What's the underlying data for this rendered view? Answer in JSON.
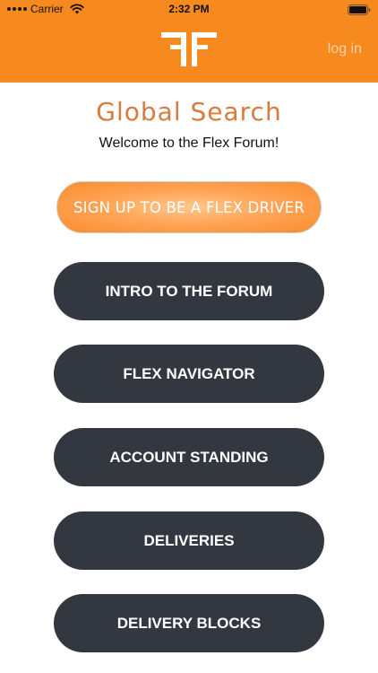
{
  "status_bar": {
    "carrier": "Carrier",
    "time": "2:32 PM"
  },
  "header": {
    "login_label": "log in",
    "brand_color": "#f78a1e"
  },
  "main": {
    "title": "Global Search",
    "welcome": "Welcome to the Flex Forum!",
    "signup_label": "SIGN UP TO BE A FLEX DRIVER",
    "menu": [
      {
        "label": "INTRO TO THE FORUM"
      },
      {
        "label": "FLEX NAVIGATOR"
      },
      {
        "label": "ACCOUNT STANDING"
      },
      {
        "label": "DELIVERIES"
      },
      {
        "label": "DELIVERY BLOCKS"
      }
    ]
  },
  "icons": {
    "signal": "signal-dots-icon",
    "wifi": "wifi-icon",
    "battery": "battery-icon",
    "logo": "flex-forum-logo"
  }
}
